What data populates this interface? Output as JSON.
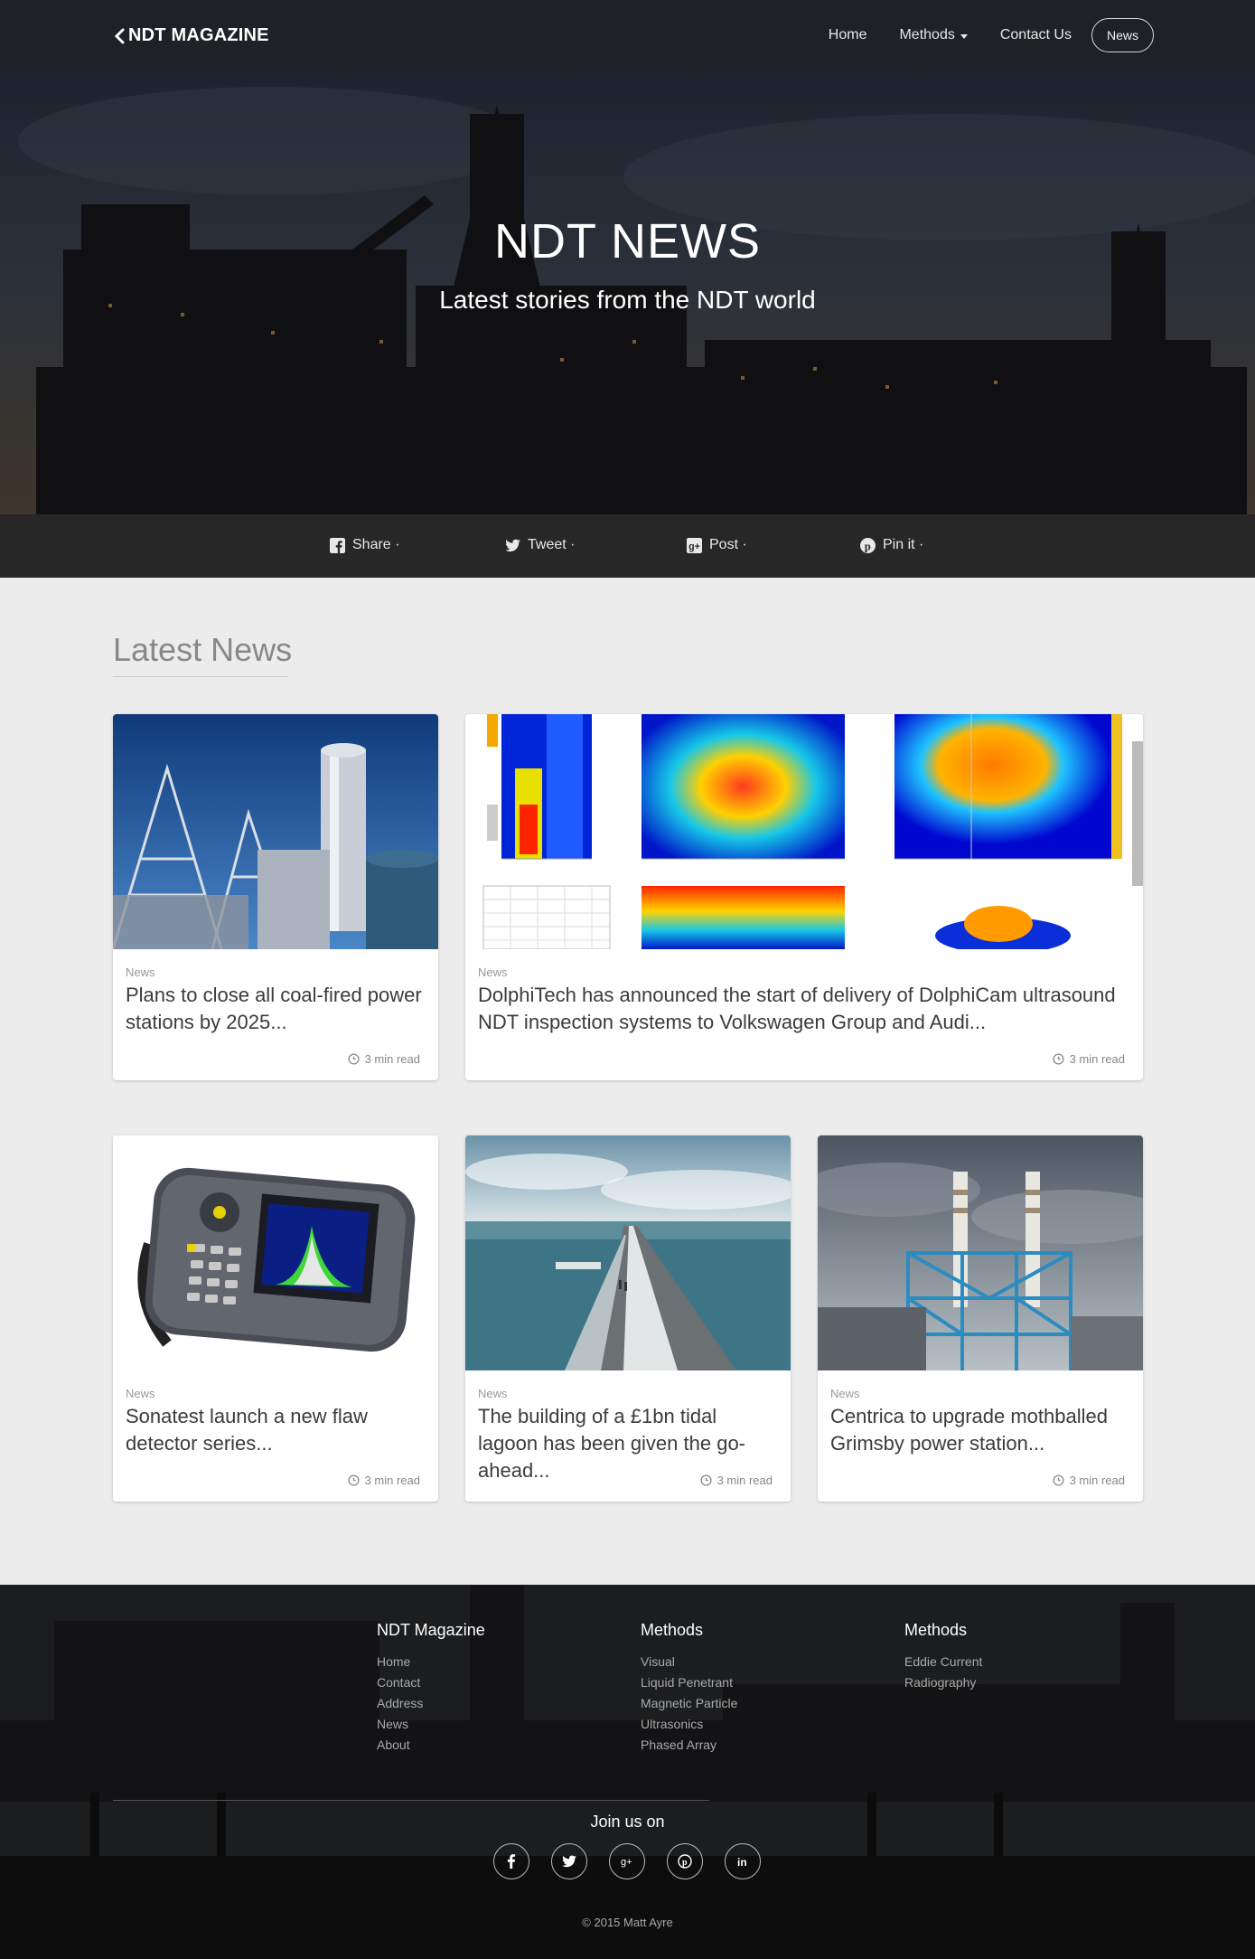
{
  "nav": {
    "brand": "NDT MAGAZINE",
    "links": [
      {
        "label": "Home"
      },
      {
        "label": "Methods"
      },
      {
        "label": "Contact Us"
      }
    ],
    "pill": "News"
  },
  "hero": {
    "title": "NDT NEWS",
    "subtitle": "Latest stories from the NDT world"
  },
  "share": {
    "items": [
      {
        "label": "Share ·",
        "icon": "facebook-icon"
      },
      {
        "label": "Tweet ·",
        "icon": "twitter-icon"
      },
      {
        "label": "Post ·",
        "icon": "google-plus-icon"
      },
      {
        "label": "Pin it ·",
        "icon": "pinterest-icon"
      }
    ]
  },
  "latest": {
    "title": "Latest News",
    "cards": [
      {
        "category": "News",
        "title": "Plans to close all coal-fired power stations by 2025...",
        "read": "3 min read"
      },
      {
        "category": "News",
        "title": "DolphiTech has announced the start of delivery of DolphiCam ultrasound NDT inspection systems to Volkswagen Group and Audi...",
        "read": "3 min read"
      },
      {
        "category": "News",
        "title": "Sonatest launch a new flaw detector series...",
        "read": "3 min read"
      },
      {
        "category": "News",
        "title": "The building of a £1bn tidal lagoon has been given the go-ahead...",
        "read": "3 min read"
      },
      {
        "category": "News",
        "title": "Centrica to upgrade mothballed Grimsby power station...",
        "read": "3 min read"
      }
    ]
  },
  "footer": {
    "col1": {
      "title": "NDT Magazine",
      "links": [
        "Home",
        "Contact",
        "Address",
        "News",
        "About"
      ]
    },
    "col2": {
      "title": "Methods",
      "links": [
        "Visual",
        "Liquid Penetrant",
        "Magnetic Particle",
        "Ultrasonics",
        "Phased Array"
      ]
    },
    "col3": {
      "title": "Methods",
      "links": [
        "Eddie Current",
        "Radiography"
      ]
    },
    "join": "Join us on",
    "socials": [
      "facebook-icon",
      "twitter-icon",
      "google-plus-icon",
      "pinterest-icon",
      "linkedin-icon"
    ],
    "copyright": "© 2015 Matt Ayre"
  },
  "colors": {
    "navbar": "#1e2125",
    "sharebar": "#272727",
    "page_bg": "#ececec"
  }
}
